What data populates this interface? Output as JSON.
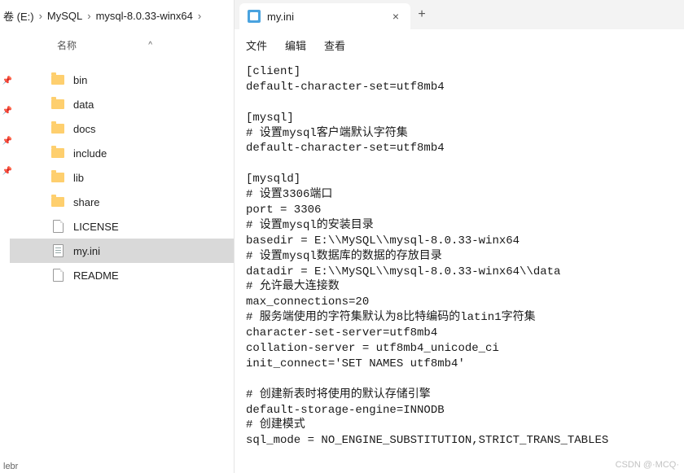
{
  "breadcrumb": {
    "seg1": "卷 (E:)",
    "seg2": "MySQL",
    "seg3": "mysql-8.0.33-winx64",
    "sep": "›"
  },
  "explorer": {
    "column_name": "名称",
    "sort_indicator": "^",
    "items": [
      {
        "name": "bin",
        "type": "folder"
      },
      {
        "name": "data",
        "type": "folder"
      },
      {
        "name": "docs",
        "type": "folder"
      },
      {
        "name": "include",
        "type": "folder"
      },
      {
        "name": "lib",
        "type": "folder"
      },
      {
        "name": "share",
        "type": "folder"
      },
      {
        "name": "LICENSE",
        "type": "file"
      },
      {
        "name": "my.ini",
        "type": "ini",
        "selected": true
      },
      {
        "name": "README",
        "type": "file"
      }
    ],
    "sidebar_truncated": "lebr"
  },
  "notepad": {
    "tab_title": "my.ini",
    "close_glyph": "×",
    "new_tab_glyph": "+",
    "menu": {
      "file": "文件",
      "edit": "编辑",
      "view": "查看"
    },
    "content": "[client]\ndefault-character-set=utf8mb4\n\n[mysql]\n# 设置mysql客户端默认字符集\ndefault-character-set=utf8mb4\n\n[mysqld]\n# 设置3306端口\nport = 3306\n# 设置mysql的安装目录\nbasedir = E:\\\\MySQL\\\\mysql-8.0.33-winx64\n# 设置mysql数据库的数据的存放目录\ndatadir = E:\\\\MySQL\\\\mysql-8.0.33-winx64\\\\data\n# 允许最大连接数\nmax_connections=20\n# 服务端使用的字符集默认为8比特编码的latin1字符集\ncharacter-set-server=utf8mb4\ncollation-server = utf8mb4_unicode_ci\ninit_connect='SET NAMES utf8mb4'\n\n# 创建新表时将使用的默认存储引擎\ndefault-storage-engine=INNODB\n# 创建模式\nsql_mode = NO_ENGINE_SUBSTITUTION,STRICT_TRANS_TABLES"
  },
  "watermark": "CSDN @·MCQ·"
}
